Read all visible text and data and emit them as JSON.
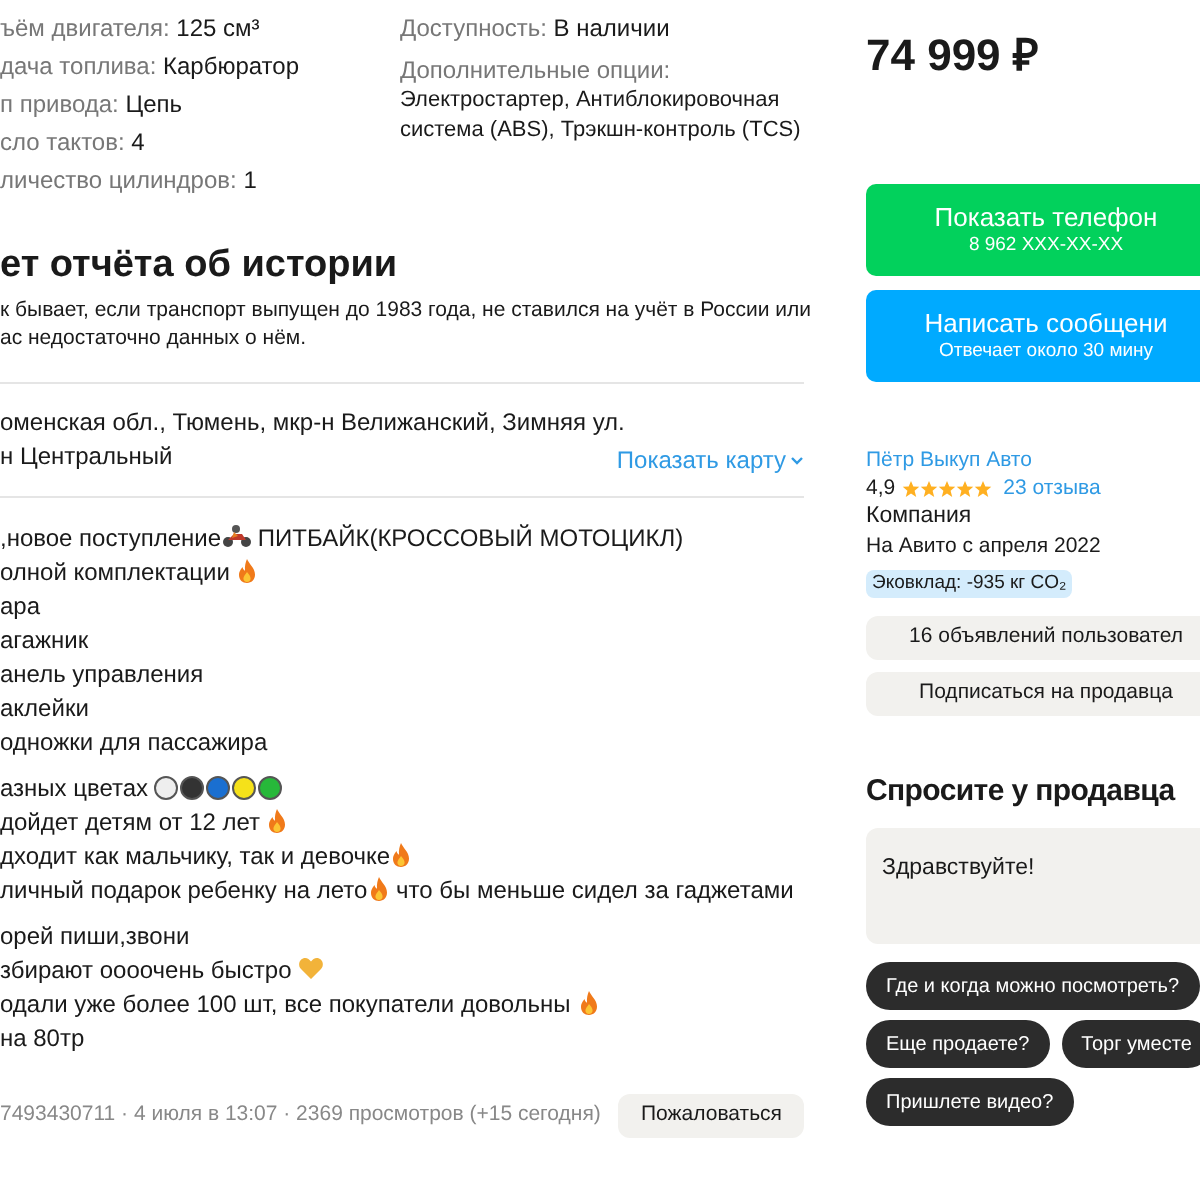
{
  "specs": {
    "left": [
      {
        "label": "ъём двигателя:",
        "value": "125 см³"
      },
      {
        "label": "дача топлива:",
        "value": "Карбюратор"
      },
      {
        "label": "п привода:",
        "value": "Цепь"
      },
      {
        "label": "сло тактов:",
        "value": "4"
      },
      {
        "label": "личество цилиндров:",
        "value": "1"
      }
    ],
    "right": [
      {
        "label": "Доступность:",
        "value": "В наличии"
      },
      {
        "label": "Дополнительные опции:",
        "value": "Электростартер, Антиблокировочная система (ABS), Трэкшн-контроль (TCS)"
      }
    ]
  },
  "history": {
    "title": "ет отчёта об истории",
    "text": "к бывает, если транспорт выпущен до 1983 года, не ставился на учёт в России или\nас недостаточно данных о нём."
  },
  "address": {
    "lines": [
      "оменская обл., Тюмень, мкр-н Велижанский, Зимняя ул.",
      "н Центральный"
    ],
    "map_link": "Показать карту"
  },
  "description": [
    [
      [
        {
          "kind": "text",
          "text": ",новое поступление"
        },
        {
          "kind": "moto"
        },
        {
          "kind": "text",
          "text": " ПИТБАЙК(КРОССОВЫЙ МОТОЦИКЛ)"
        }
      ],
      [
        {
          "kind": "text",
          "text": "олной комплектации "
        },
        {
          "kind": "fire"
        }
      ],
      [
        {
          "kind": "text",
          "text": "ара"
        }
      ],
      [
        {
          "kind": "text",
          "text": "агажник"
        }
      ],
      [
        {
          "kind": "text",
          "text": "анель управления"
        }
      ],
      [
        {
          "kind": "text",
          "text": "аклейки"
        }
      ],
      [
        {
          "kind": "text",
          "text": "одножки для пассажира"
        }
      ]
    ],
    [
      [
        {
          "kind": "text",
          "text": "азных цветах "
        },
        {
          "kind": "dot",
          "color": "#eeeeee"
        },
        {
          "kind": "dot",
          "color": "#333333"
        },
        {
          "kind": "dot",
          "color": "#1a6fd1"
        },
        {
          "kind": "dot",
          "color": "#f5e11a"
        },
        {
          "kind": "dot",
          "color": "#27b83a"
        }
      ],
      [
        {
          "kind": "text",
          "text": "дойдет детям от 12 лет "
        },
        {
          "kind": "fire"
        }
      ],
      [
        {
          "kind": "text",
          "text": "дходит как мальчику, так и девочке"
        },
        {
          "kind": "fire"
        }
      ],
      [
        {
          "kind": "text",
          "text": "личный подарок ребенку на лето"
        },
        {
          "kind": "fire"
        },
        {
          "kind": "text",
          "text": " что бы меньше сидел за гаджетами"
        }
      ]
    ],
    [
      [
        {
          "kind": "text",
          "text": "орей пиши,звони"
        }
      ],
      [
        {
          "kind": "text",
          "text": "збирают оооочень быстро "
        },
        {
          "kind": "heart"
        }
      ],
      [
        {
          "kind": "text",
          "text": "одали уже более 100 шт, все покупатели довольны "
        },
        {
          "kind": "fire"
        }
      ],
      [
        {
          "kind": "text",
          "text": "на 80тр"
        }
      ]
    ]
  ],
  "footer": {
    "meta": "7493430711 · 4 июля в 13:07 · 2369 просмотров (+15 сегодня)",
    "report_button": "Пожаловаться"
  },
  "price": "74 999 ₽",
  "phone_button": {
    "label": "Показать телефон",
    "sub": "8 962 XXX-XX-XX"
  },
  "message_button": {
    "label": "Написать сообщени",
    "sub": "Отвечает около 30 мину"
  },
  "seller": {
    "name": "Пётр Выкуп Авто",
    "rating": "4,9",
    "stars": 5,
    "reviews": "23 отзыва",
    "type": "Компания",
    "since": "На Авито с апреля 2022",
    "eco": "Эковклад: -935 кг CO₂",
    "ads_button": "16 объявлений пользовател",
    "subscribe_button": "Подписаться на продавца"
  },
  "ask": {
    "title": "Спросите у продавца",
    "message": "Здравствуйте!",
    "chips": [
      [
        "Где и когда можно посмотреть?"
      ],
      [
        "Еще продаете?",
        "Торг уместе"
      ],
      [
        "Пришлете видео?"
      ]
    ]
  }
}
